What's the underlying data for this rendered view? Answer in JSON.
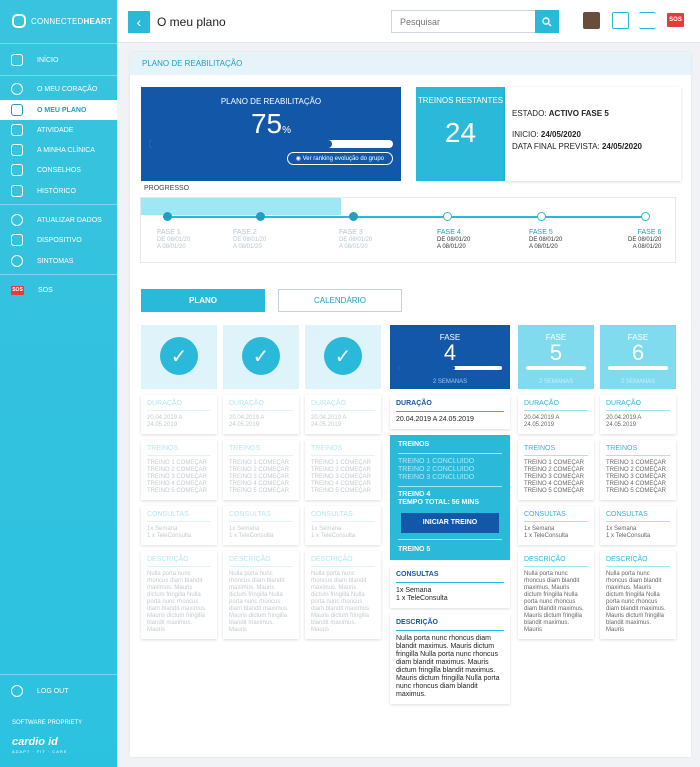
{
  "brand": {
    "light": "CONNECTED",
    "bold": "HEART"
  },
  "nav": [
    {
      "label": "INÍCIO",
      "icon": "home-icon"
    },
    {
      "label": "O MEU CORAÇÃO",
      "icon": "heart-icon"
    },
    {
      "label": "O MEU PLANO",
      "icon": "plan-icon"
    },
    {
      "label": "ATIVIDADE",
      "icon": "dumbbell-icon"
    },
    {
      "label": "A MINHA CLÍNICA",
      "icon": "clinic-icon"
    },
    {
      "label": "CONSELHOS",
      "icon": "advice-icon"
    },
    {
      "label": "HISTÓRICO",
      "icon": "history-icon"
    },
    {
      "label": "ATUALIZAR DADOS",
      "icon": "update-icon"
    },
    {
      "label": "DISPOSITIVO",
      "icon": "device-icon"
    },
    {
      "label": "SINTOMAS",
      "icon": "symptoms-icon"
    },
    {
      "label": "SOS",
      "icon": "sos-icon"
    }
  ],
  "logout": "LOG OUT",
  "software": "SOFTWARE PROPRIETY",
  "cardio": {
    "name": "cardio id",
    "tag": "ADAPT · FIT · CARE"
  },
  "header": {
    "title": "O meu plano",
    "search_placeholder": "Pesquisar",
    "sos": "SOS"
  },
  "section_title": "PLANO DE REABILITAÇÃO",
  "plan": {
    "label": "PLANO DE REABILITAÇÃO",
    "value": "75",
    "unit": "%",
    "progress": 0.75,
    "ranking": "Ver ranking evolução do grupo"
  },
  "treinos": {
    "label": "TREINOS RESTANTES",
    "value": "24"
  },
  "estado": {
    "estado_label": "ESTADO:",
    "estado_value": "ACTIVO FASE 5",
    "inicio_label": "INICIO:",
    "inicio_value": "24/05/2020",
    "final_label": "DATA FINAL PREVISTA:",
    "final_value": "24/05/2020"
  },
  "progress_label": "PROGRESSO",
  "phases": [
    {
      "name": "FASE 1",
      "de": "DE 08/01/20",
      "a": "A 08/01/20",
      "done": true
    },
    {
      "name": "FASE 2",
      "de": "DE 08/01/20",
      "a": "A 08/01/20",
      "done": true
    },
    {
      "name": "FASE 3",
      "de": "DE 08/01/20",
      "a": "A 08/01/20",
      "done": true
    },
    {
      "name": "FASE 4",
      "de": "DE 08/01/20",
      "a": "A 08/01/20",
      "done": false
    },
    {
      "name": "FASE 5",
      "de": "DE 08/01/20",
      "a": "A 08/01/20",
      "done": false
    },
    {
      "name": "FASE 6",
      "de": "DE 08/01/20",
      "a": "A 08/01/20",
      "done": false
    }
  ],
  "tabs": {
    "plano": "PLANO",
    "calendario": "CALENDÁRIO"
  },
  "labels": {
    "duracao": "DURAÇÃO",
    "treinos": "TREINOS",
    "consultas": "CONSULTAS",
    "descricao": "DESCRIÇÃO",
    "fase": "FASE",
    "semanas": "2 SEMANAS"
  },
  "card": {
    "duracao": "20.04.2019 A 24.05.2019",
    "treinos": [
      "TREINO 1 COMEÇAR",
      "TREINO 2 COMEÇAR",
      "TREINO 3 COMEÇAR",
      "TREINO 4 COMEÇAR",
      "TREINO 5 COMEÇAR"
    ],
    "consultas": [
      "1x Semana",
      "1 x TeleConsulta"
    ],
    "descricao": "Nulla porta nunc rhoncus diam blandit maximus. Mauris dictum fringilla Nulla porta nunc rhoncus diam blandit maximus. Mauris dictum fringilla blandit maximus. Mauris"
  },
  "fase4": {
    "number": "4",
    "progress": 0.55,
    "duracao": "20.04.2019 A 24.05.2019",
    "treinos_done": [
      "TREINO 1 CONCLUIDO",
      "TREINO 2 CONCLUIDO",
      "TREINO 3 CONCLUIDO"
    ],
    "treino4": "TREINO 4",
    "tempo": "TEMPO TOTAL: 56 MINS",
    "iniciar": "INICIAR TREINO",
    "treino5": "TREINO 5",
    "consultas": [
      "1x Semana",
      "1 x TeleConsulta"
    ],
    "descricao": "Nulla porta nunc rhoncus diam blandit maximus. Mauris dictum fringilla Nulla porta nunc rhoncus diam blandit maximus. Mauris dictum fringilla blandit maximus. Mauris dictum fringilla Nulla porta nunc rhoncus diam blandit maximus."
  },
  "fase5": {
    "number": "5"
  },
  "fase6": {
    "number": "6"
  },
  "colors": {
    "primary": "#2bb9d9",
    "dark": "#1358a8",
    "sos": "#e63b3b"
  }
}
